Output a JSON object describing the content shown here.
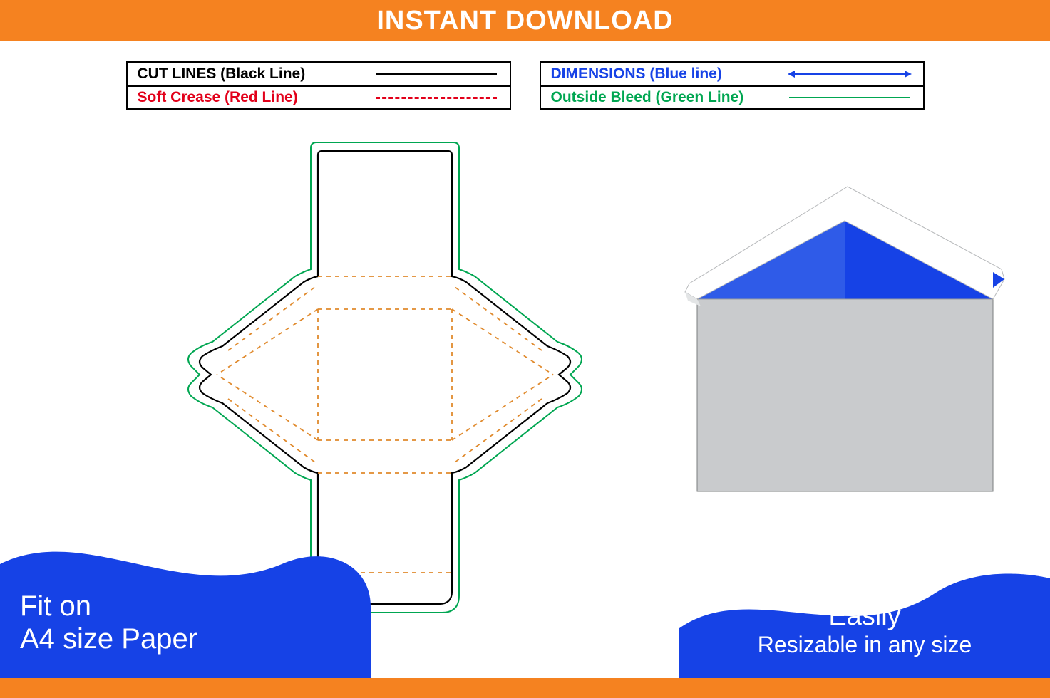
{
  "header": {
    "title": "INSTANT DOWNLOAD"
  },
  "legend": {
    "left": {
      "row1": "CUT LINES (Black Line)",
      "row2": "Soft Crease (Red Line)"
    },
    "right": {
      "row1": "DIMENSIONS (Blue line)",
      "row2": "Outside Bleed (Green Line)"
    }
  },
  "colors": {
    "orange": "#f58220",
    "blue": "#1642e6",
    "red": "#e2001a",
    "green": "#00a651",
    "crease": "#e08a2d",
    "envelope_grey": "#c9cbcd",
    "envelope_blue": "#1642e6",
    "envelope_blue2": "#2f5be8"
  },
  "labels": {
    "fit_line1": "Fit on",
    "fit_line2": "A4 size Paper",
    "resize_line1": "Easily",
    "resize_line2": "Resizable in any size"
  }
}
